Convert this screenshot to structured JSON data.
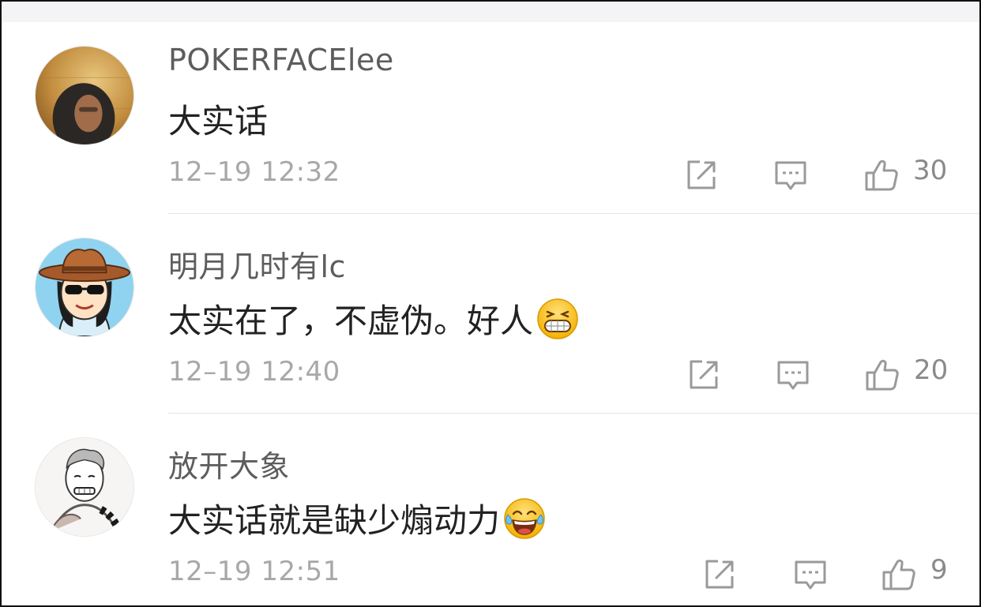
{
  "comments": [
    {
      "username": "POKERFACElee",
      "text": "大实话",
      "time": "12–19 12:32",
      "likes": "30",
      "emoji": null,
      "avatar": "hooded-person-avatar"
    },
    {
      "username": "明月几时有lc",
      "text": "太实在了，不虚伪。好人",
      "time": "12–19 12:40",
      "likes": "20",
      "emoji": "grinning-teeth-emoji",
      "avatar": "cowboy-hat-cartoon-avatar"
    },
    {
      "username": "放开大象",
      "text": "大实话就是缺少煽动力",
      "time": "12–19 12:51",
      "likes": "9",
      "emoji": "tears-of-joy-emoji",
      "avatar": "sketch-man-avatar"
    }
  ],
  "icons": {
    "share": "share-icon",
    "reply": "comment-icon",
    "like": "thumbs-up-icon"
  },
  "colors": {
    "username": "#5d5d5d",
    "text": "#222222",
    "time": "#a8a8a8",
    "icon": "#9a9a9a",
    "divider": "#e3e3e3"
  }
}
